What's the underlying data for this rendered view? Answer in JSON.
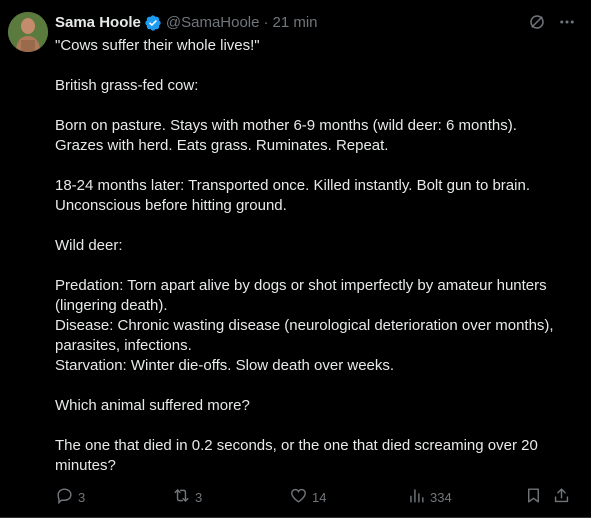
{
  "author": {
    "name": "Sama Hoole",
    "handle": "@SamaHoole",
    "separator": "·",
    "time": "21 min"
  },
  "tweet": {
    "lines": [
      "\"Cows suffer their whole lives!\"",
      "",
      "British grass-fed cow:",
      "",
      "Born on pasture. Stays with mother 6-9 months (wild deer: 6 months).",
      "Grazes with herd. Eats grass. Ruminates. Repeat.",
      "",
      "18-24 months later: Transported once. Killed instantly. Bolt gun to brain.",
      "Unconscious before hitting ground.",
      "",
      "Wild deer:",
      "",
      "Predation: Torn apart alive by dogs or shot imperfectly by amateur hunters",
      "(lingering death).",
      "Disease: Chronic wasting disease (neurological deterioration over months),",
      "parasites, infections.",
      "Starvation: Winter die-offs. Slow death over weeks.",
      "",
      "Which animal suffered more?",
      "",
      "The one that died in 0.2 seconds, or the one that died screaming over 20",
      "minutes?"
    ]
  },
  "stats": {
    "replies": "3",
    "retweets": "3",
    "likes": "14",
    "views": "334"
  },
  "icons": {
    "verified": "verified-badge-icon",
    "grok": "grok-icon",
    "more": "more-icon",
    "reply": "reply-icon",
    "retweet": "retweet-icon",
    "like": "heart-icon",
    "views": "views-icon",
    "bookmark": "bookmark-icon",
    "share": "share-icon"
  },
  "colors": {
    "background": "#000000",
    "text": "#e7e9ea",
    "muted": "#71767b",
    "verified": "#1d9bf0"
  }
}
